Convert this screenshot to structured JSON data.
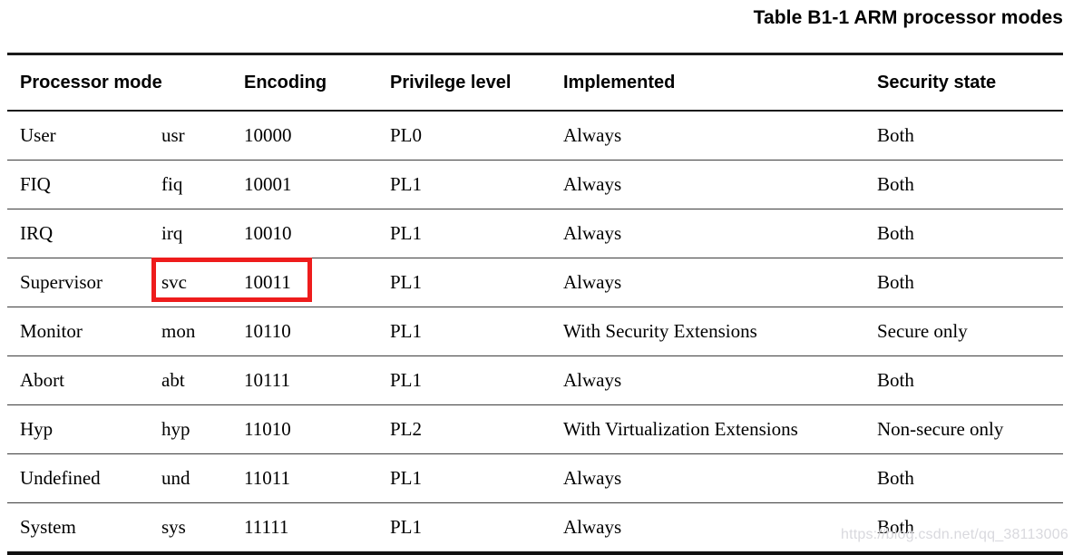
{
  "caption": "Table B1-1 ARM processor modes",
  "table": {
    "columns": [
      {
        "key": "mode",
        "label": "Processor mode"
      },
      {
        "key": "abbr",
        "label": ""
      },
      {
        "key": "encoding",
        "label": "Encoding"
      },
      {
        "key": "privilege",
        "label": "Privilege level"
      },
      {
        "key": "implemented",
        "label": "Implemented"
      },
      {
        "key": "security",
        "label": "Security state"
      }
    ],
    "rows": [
      {
        "mode": "User",
        "abbr": "usr",
        "encoding": "10000",
        "privilege": "PL0",
        "implemented": "Always",
        "security": "Both"
      },
      {
        "mode": "FIQ",
        "abbr": "fiq",
        "encoding": "10001",
        "privilege": "PL1",
        "implemented": "Always",
        "security": "Both"
      },
      {
        "mode": "IRQ",
        "abbr": "irq",
        "encoding": "10010",
        "privilege": "PL1",
        "implemented": "Always",
        "security": "Both"
      },
      {
        "mode": "Supervisor",
        "abbr": "svc",
        "encoding": "10011",
        "privilege": "PL1",
        "implemented": "Always",
        "security": "Both"
      },
      {
        "mode": "Monitor",
        "abbr": "mon",
        "encoding": "10110",
        "privilege": "PL1",
        "implemented": "With Security Extensions",
        "security": "Secure only"
      },
      {
        "mode": "Abort",
        "abbr": "abt",
        "encoding": "10111",
        "privilege": "PL1",
        "implemented": "Always",
        "security": "Both"
      },
      {
        "mode": "Hyp",
        "abbr": "hyp",
        "encoding": "11010",
        "privilege": "PL2",
        "implemented": "With Virtualization Extensions",
        "security": "Non-secure only"
      },
      {
        "mode": "Undefined",
        "abbr": "und",
        "encoding": "11011",
        "privilege": "PL1",
        "implemented": "Always",
        "security": "Both"
      },
      {
        "mode": "System",
        "abbr": "sys",
        "encoding": "11111",
        "privilege": "PL1",
        "implemented": "Always",
        "security": "Both"
      }
    ]
  },
  "annotation": {
    "type": "red-rectangle",
    "color": "#ee1c1c",
    "targets": [
      "svc",
      "10011"
    ],
    "row": "Supervisor"
  },
  "watermark": {
    "text": "https://blog.csdn.net/qq_38113006",
    "color": "#d9d9de"
  }
}
